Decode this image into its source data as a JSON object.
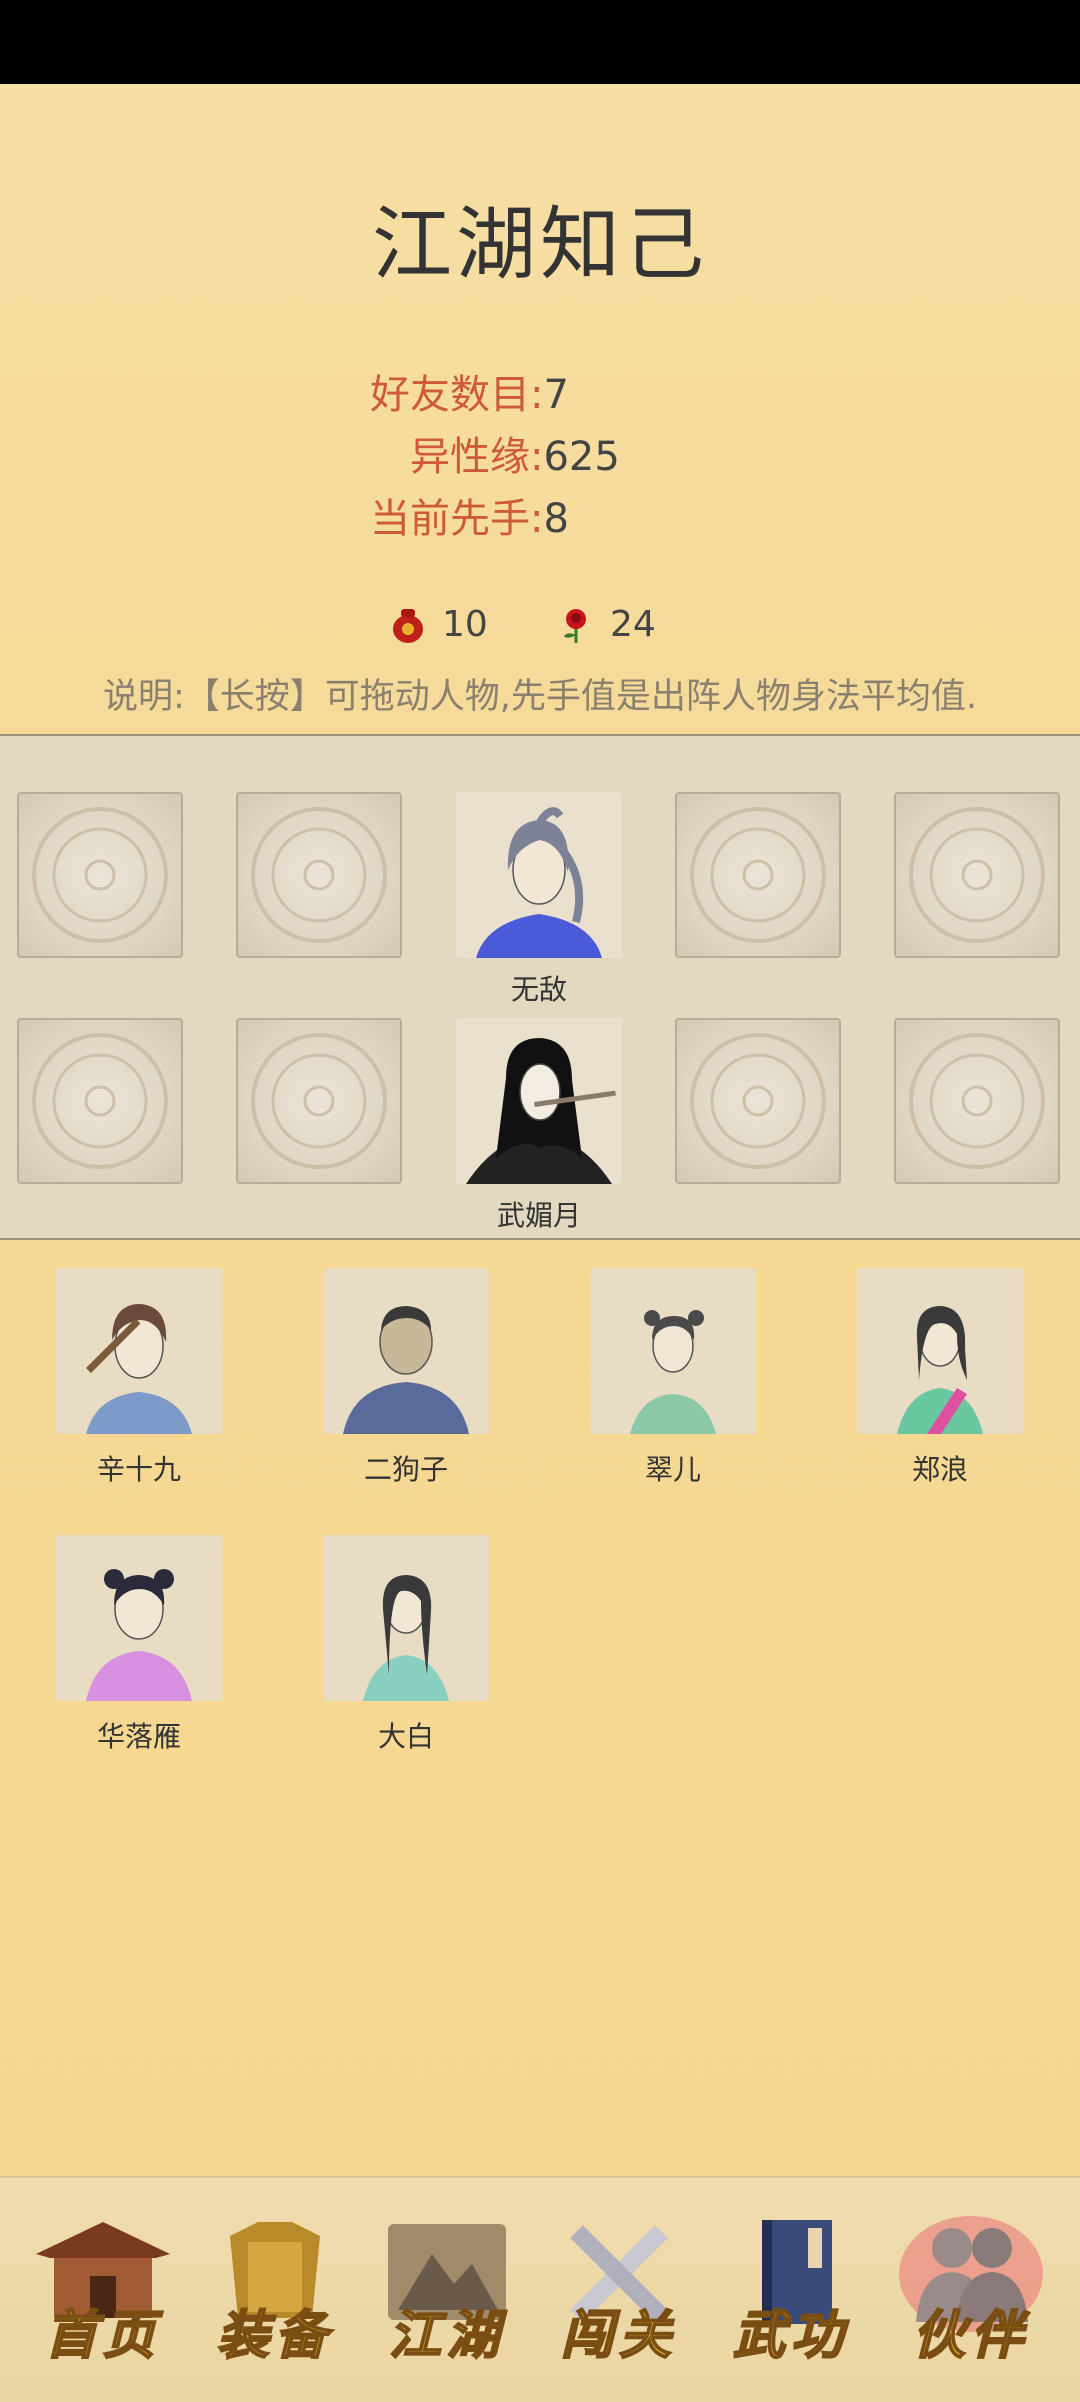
{
  "page": {
    "title": "江湖知己"
  },
  "stats": [
    {
      "label": "好友数目:",
      "value": "7"
    },
    {
      "label": "异性缘:",
      "value": "625"
    },
    {
      "label": "当前先手:",
      "value": "8"
    }
  ],
  "currency": [
    {
      "icon": "red-pouch-icon",
      "amount": "10"
    },
    {
      "icon": "rose-icon",
      "amount": "24"
    }
  ],
  "description": "说明:【长按】可拖动人物,先手值是出阵人物身法平均值.",
  "lineup": {
    "row1_name": "无敌",
    "row2_name": "武媚月"
  },
  "friends": [
    {
      "name": "辛十九"
    },
    {
      "name": "二狗子"
    },
    {
      "name": "翠儿"
    },
    {
      "name": "郑浪"
    },
    {
      "name": "华落雁"
    },
    {
      "name": "大白"
    }
  ],
  "nav": [
    {
      "label": "首页",
      "icon": "house-icon"
    },
    {
      "label": "装备",
      "icon": "armor-icon"
    },
    {
      "label": "江湖",
      "icon": "scroll-map-icon"
    },
    {
      "label": "闯关",
      "icon": "crossed-swords-icon"
    },
    {
      "label": "武功",
      "icon": "book-icon"
    },
    {
      "label": "伙伴",
      "icon": "partners-icon",
      "active": true
    }
  ]
}
